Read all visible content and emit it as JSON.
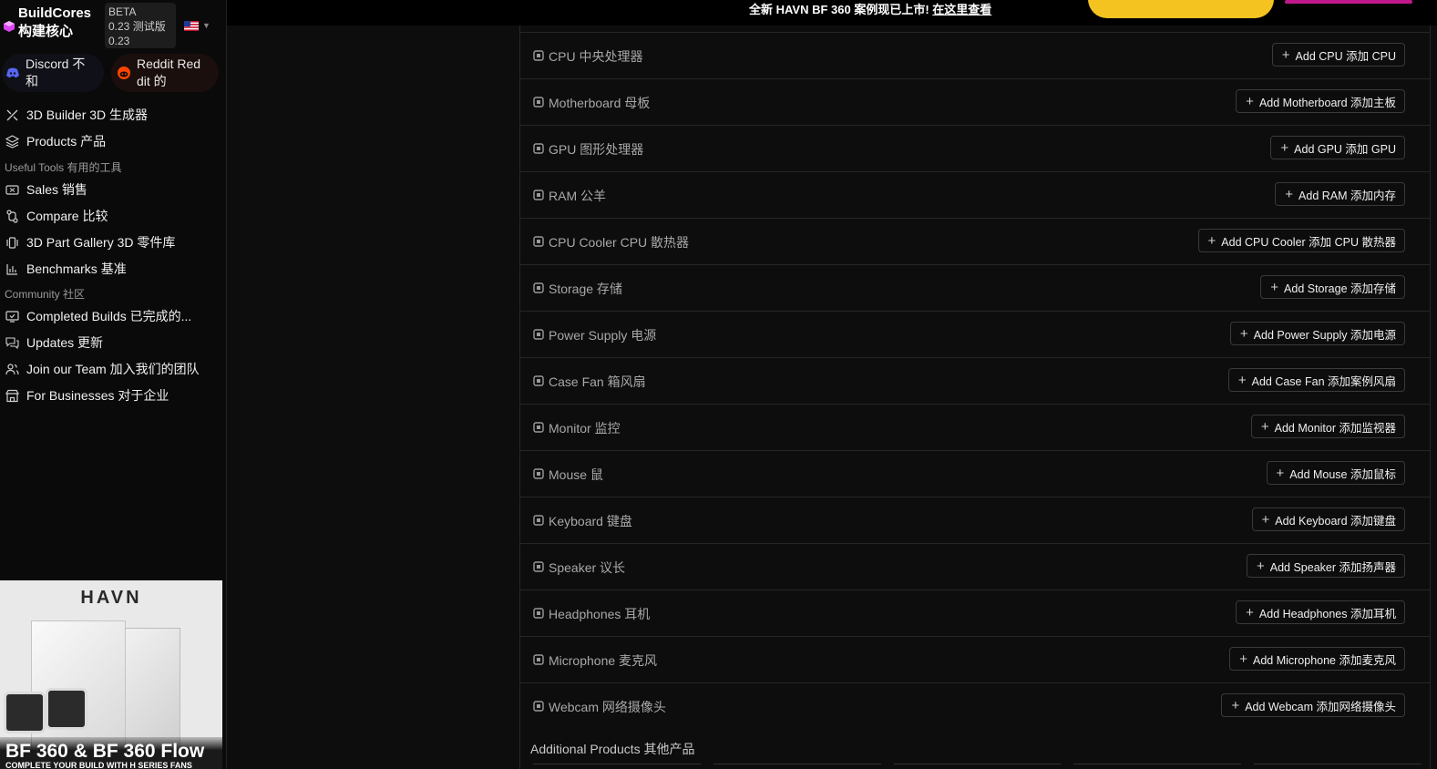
{
  "banner": {
    "text": "全新 HAVN BF 360 案例现已上市!",
    "link": "在这里查看",
    "colors": {
      "pill": "#f4c320",
      "accent": "#c0188c"
    }
  },
  "brand": {
    "name_line1": "BuildCores",
    "name_line2": "构建核心",
    "logo_icon": "cube-icon"
  },
  "beta": {
    "line1": "BETA",
    "line2": "0.23 测试版",
    "line3": "0.23"
  },
  "locale": {
    "flag_icon": "us-flag-icon"
  },
  "social": {
    "discord": {
      "label_line1": "Discord 不",
      "label_line2": "和",
      "icon": "discord-icon"
    },
    "reddit": {
      "label_line1": "Reddit Red",
      "label_line2": "dit 的",
      "icon": "reddit-icon"
    }
  },
  "nav": {
    "builder": "3D Builder  3D 生成器",
    "products": "Products  产品",
    "useful_tools": "Useful Tools  有用的工具",
    "sales": "Sales  销售",
    "compare": "Compare  比较",
    "gallery": "3D Part Gallery  3D 零件库",
    "benchmarks": "Benchmarks  基准",
    "community": "Community  社区",
    "completed_builds": "Completed Builds  已完成的...",
    "updates": "Updates  更新",
    "join_team": "Join our Team  加入我们的团队",
    "businesses": "For Businesses  对于企业"
  },
  "ad": {
    "logo": "HAVN",
    "title": "BF 360 & BF 360 Flow",
    "subtitle": "COMPLETE YOUR BUILD WITH H SERIES FANS"
  },
  "parts": [
    {
      "label": "CPU   中央处理器",
      "button": "Add CPU  添加 CPU",
      "icon": "cpu-icon"
    },
    {
      "label": "Motherboard   母板",
      "button": "Add Motherboard  添加主板",
      "icon": "motherboard-icon"
    },
    {
      "label": "GPU   图形处理器",
      "button": "Add GPU  添加 GPU",
      "icon": "gpu-icon"
    },
    {
      "label": "RAM   公羊",
      "button": "Add RAM  添加内存",
      "icon": "ram-icon"
    },
    {
      "label": "CPU Cooler   CPU 散热器",
      "button": "Add CPU Cooler  添加 CPU 散热器",
      "icon": "cpu-cooler-icon"
    },
    {
      "label": "Storage   存储",
      "button": "Add Storage  添加存储",
      "icon": "storage-icon"
    },
    {
      "label": "Power Supply   电源",
      "button": "Add Power Supply  添加电源",
      "icon": "power-supply-icon"
    },
    {
      "label": "Case Fan   箱风扇",
      "button": "Add Case Fan  添加案例风扇",
      "icon": "case-fan-icon"
    },
    {
      "label": "Monitor   监控",
      "button": "Add Monitor  添加监视器",
      "icon": "monitor-icon"
    },
    {
      "label": "Mouse   鼠",
      "button": "Add Mouse  添加鼠标",
      "icon": "mouse-icon"
    },
    {
      "label": "Keyboard   键盘",
      "button": "Add Keyboard  添加键盘",
      "icon": "keyboard-icon"
    },
    {
      "label": "Speaker   议长",
      "button": "Add Speaker  添加扬声器",
      "icon": "speaker-icon"
    },
    {
      "label": "Headphones   耳机",
      "button": "Add Headphones  添加耳机",
      "icon": "headphones-icon"
    },
    {
      "label": "Microphone   麦克风",
      "button": "Add Microphone  添加麦克风",
      "icon": "microphone-icon"
    },
    {
      "label": "Webcam   网络摄像头",
      "button": "Add Webcam  添加网络摄像头",
      "icon": "webcam-icon"
    }
  ],
  "additional_products": "Additional Products  其他产品"
}
